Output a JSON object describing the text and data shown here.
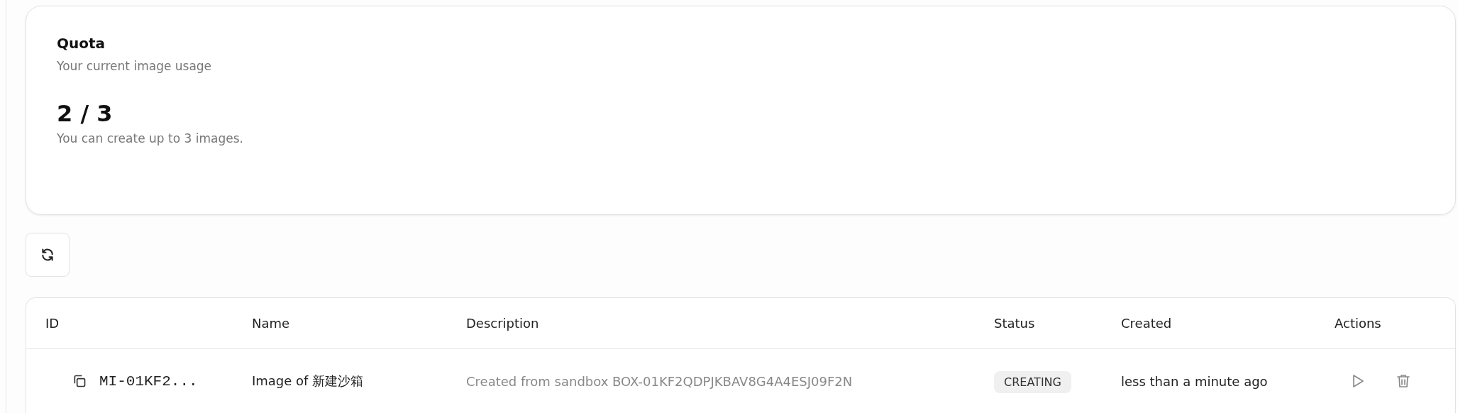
{
  "quota": {
    "title": "Quota",
    "subtitle": "Your current image usage",
    "usage": "2 / 3",
    "note": "You can create up to 3 images."
  },
  "table": {
    "columns": [
      "ID",
      "Name",
      "Description",
      "Status",
      "Created",
      "Actions"
    ],
    "rows": [
      {
        "id": "MI-01KF2...",
        "name": "Image of 新建沙箱",
        "description": "Created from sandbox BOX-01KF2QDPJKBAV8G4A4ESJ09F2N",
        "status": "CREATING",
        "created": "less than a minute ago"
      }
    ]
  }
}
